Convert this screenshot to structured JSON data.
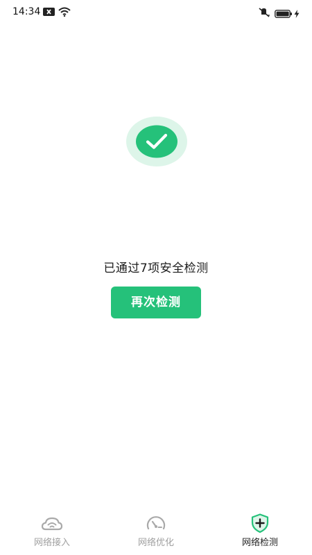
{
  "status_bar": {
    "time": "14:34",
    "icons": [
      "notification-icon",
      "wifi-icon",
      "mute-icon",
      "battery-icon",
      "charging-icon"
    ]
  },
  "result": {
    "icon": "check-circle-icon",
    "text": "已通过7项安全检测",
    "accent": "#25c17a",
    "accent_light": "#ddf5e9"
  },
  "recheck_button": {
    "label": "再次检测"
  },
  "tabbar": {
    "tabs": [
      {
        "label": "网络接入",
        "icon": "cloud-wifi-icon",
        "active": false
      },
      {
        "label": "网络优化",
        "icon": "speedometer-icon",
        "active": false
      },
      {
        "label": "网络检测",
        "icon": "shield-plus-icon",
        "active": true
      }
    ],
    "inactive_color": "#a0a0a0",
    "active_color": "#222222"
  }
}
